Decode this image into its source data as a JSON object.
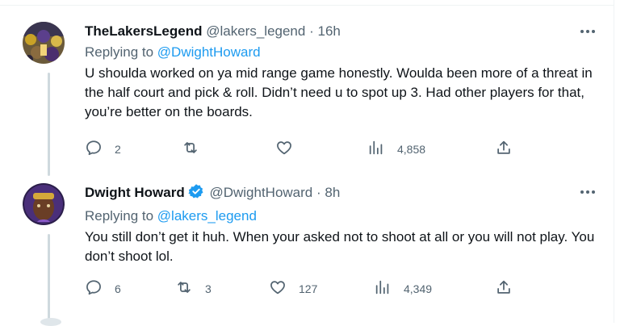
{
  "tweets": [
    {
      "display_name": "TheLakersLegend",
      "handle": "@lakers_legend",
      "separator": "·",
      "time": "16h",
      "replying_prefix": "Replying to",
      "replying_to": "@DwightHoward",
      "text": "U shoulda worked on ya mid range game honestly. Woulda been more of a threat in the half court and pick & roll. Didn’t need u to spot up 3. Had other players for that, you’re better on the boards.",
      "verified": false,
      "metrics": {
        "replies": "2",
        "retweets": "",
        "likes": "",
        "views": "4,858"
      }
    },
    {
      "display_name": "Dwight Howard",
      "handle": "@DwightHoward",
      "separator": "·",
      "time": "8h",
      "replying_prefix": "Replying to",
      "replying_to": "@lakers_legend",
      "text": "You still don’t get it huh.  When your asked not to shoot at all or you will not play. You don’t shoot lol.",
      "verified": true,
      "metrics": {
        "replies": "6",
        "retweets": "3",
        "likes": "127",
        "views": "4,349"
      }
    }
  ],
  "icons": [
    "more-icon",
    "reply-icon",
    "retweet-icon",
    "like-icon",
    "views-icon",
    "share-icon",
    "verified-badge-icon"
  ],
  "colors": {
    "accent": "#1d9bf0",
    "muted": "#536471",
    "text": "#0f1419",
    "thread_line": "#cfd9de"
  }
}
